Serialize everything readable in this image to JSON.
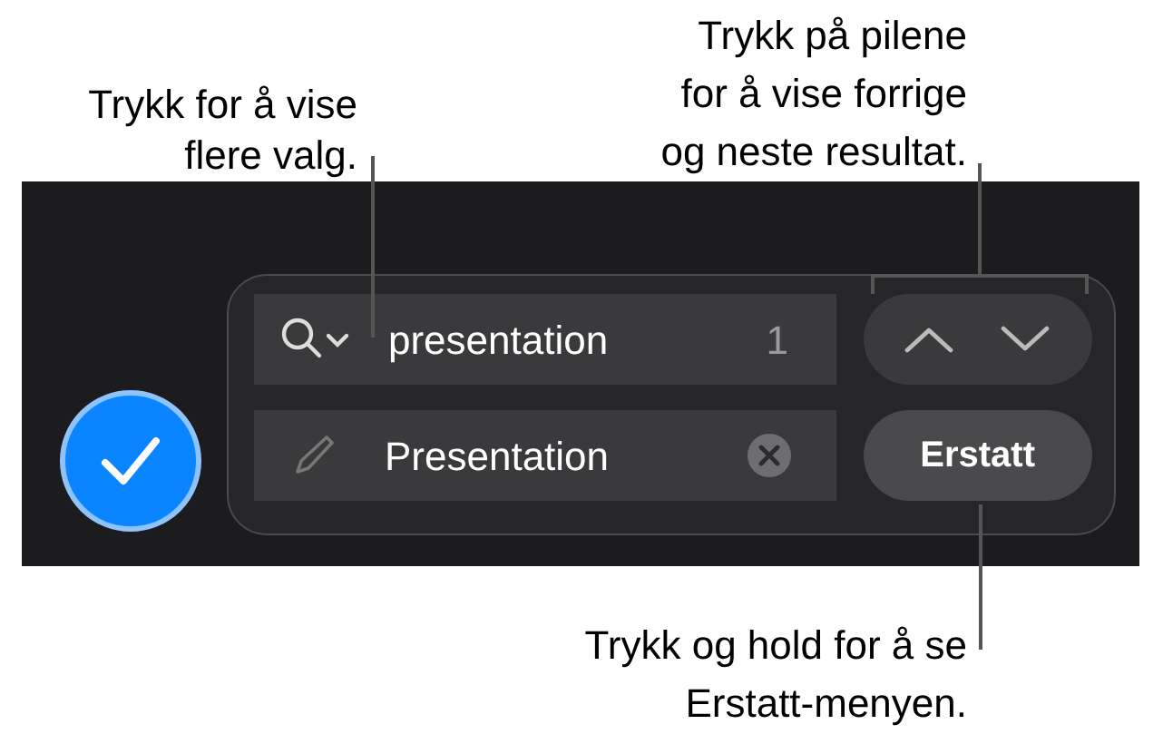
{
  "callouts": [
    {
      "lines": [
        "Trykk for å vise",
        "flere valg."
      ]
    },
    {
      "lines": [
        "Trykk på pilene",
        "for å vise forrige",
        "og neste resultat."
      ]
    },
    {
      "lines": [
        "Trykk og hold for å se",
        "Erstatt-menyen."
      ]
    }
  ],
  "find_field": {
    "value": "presentation",
    "count": "1"
  },
  "replace_field": {
    "value": "Presentation"
  },
  "replace_button": "Erstatt"
}
